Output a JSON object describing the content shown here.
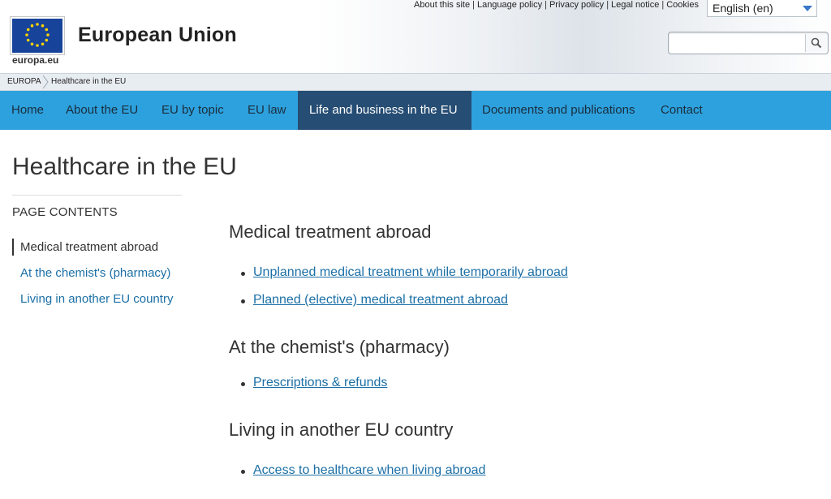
{
  "header": {
    "site_title": "European Union",
    "logo_label": "europa.eu",
    "top_links": [
      "About this site",
      "Language policy",
      "Privacy policy",
      "Legal notice",
      "Cookies"
    ],
    "language": "English (en)",
    "search": {
      "value": "",
      "placeholder": ""
    }
  },
  "breadcrumb": [
    "EUROPA",
    "Healthcare in the EU"
  ],
  "nav": {
    "items": [
      "Home",
      "About the EU",
      "EU by topic",
      "EU law",
      "Life and business in the EU",
      "Documents and publications",
      "Contact"
    ],
    "active_index": 4
  },
  "page": {
    "title": "Healthcare in the EU",
    "toc_heading": "PAGE CONTENTS",
    "toc": [
      "Medical treatment abroad",
      "At the chemist's (pharmacy)",
      "Living in another EU country"
    ],
    "sections": [
      {
        "heading": "Medical treatment abroad",
        "links": [
          "Unplanned medical treatment while temporarily abroad",
          "Planned (elective) medical treatment abroad"
        ]
      },
      {
        "heading": "At the chemist's (pharmacy)",
        "links": [
          "Prescriptions & refunds"
        ]
      },
      {
        "heading": "Living in another EU country",
        "links": [
          "Access to healthcare when living abroad"
        ]
      }
    ]
  },
  "colors": {
    "nav_background": "#2da1dd",
    "nav_active": "#264d73",
    "link": "#1b6fa6",
    "flag_blue": "#17439a",
    "flag_star": "#ffd400"
  }
}
